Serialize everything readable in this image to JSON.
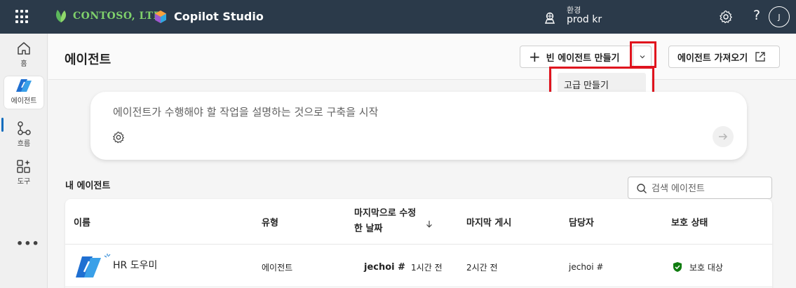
{
  "topbar": {
    "company_name": "CONTOSO, LTD.",
    "app_name": "Copilot Studio",
    "env_label": "환경",
    "env_value": "prod kr",
    "help_glyph": "?",
    "avatar_initial": "J"
  },
  "rail": {
    "items": [
      {
        "label": "홈",
        "icon": "home-icon"
      },
      {
        "label": "에이전트",
        "icon": "agents-icon",
        "active": true
      },
      {
        "label": "흐름",
        "icon": "flows-icon"
      },
      {
        "label": "도구",
        "icon": "tools-icon"
      }
    ],
    "more": "•••"
  },
  "header": {
    "title": "에이전트",
    "new_agent_label": "빈 에이전트 만들기",
    "import_label": "에이전트 가져오기",
    "dropdown_item": "고급 만들기"
  },
  "prompt": {
    "placeholder": "에이전트가 수행해야 할 작업을 설명하는 것으로 구축을 시작"
  },
  "my_agents": {
    "title": "내 에이전트",
    "search_placeholder": "검색 에이전트",
    "columns": {
      "name": "이름",
      "type": "유형",
      "modified_line1": "마지막으로 수정",
      "modified_line2": "한 날짜",
      "published": "마지막 게시",
      "owner": "담당자",
      "protection": "보호 상태"
    },
    "rows": [
      {
        "name": "HR 도우미",
        "type": "에이전트",
        "modified_by": "jechoi #",
        "modified_time": "1시간 전",
        "published": "2시간 전",
        "owner": "jechoi #",
        "protection": "보호 대상"
      }
    ]
  },
  "colors": {
    "topbar": "#2b3a4a",
    "accent": "#0f6cbd",
    "highlight": "#e0141e",
    "protected": "#107c10"
  }
}
